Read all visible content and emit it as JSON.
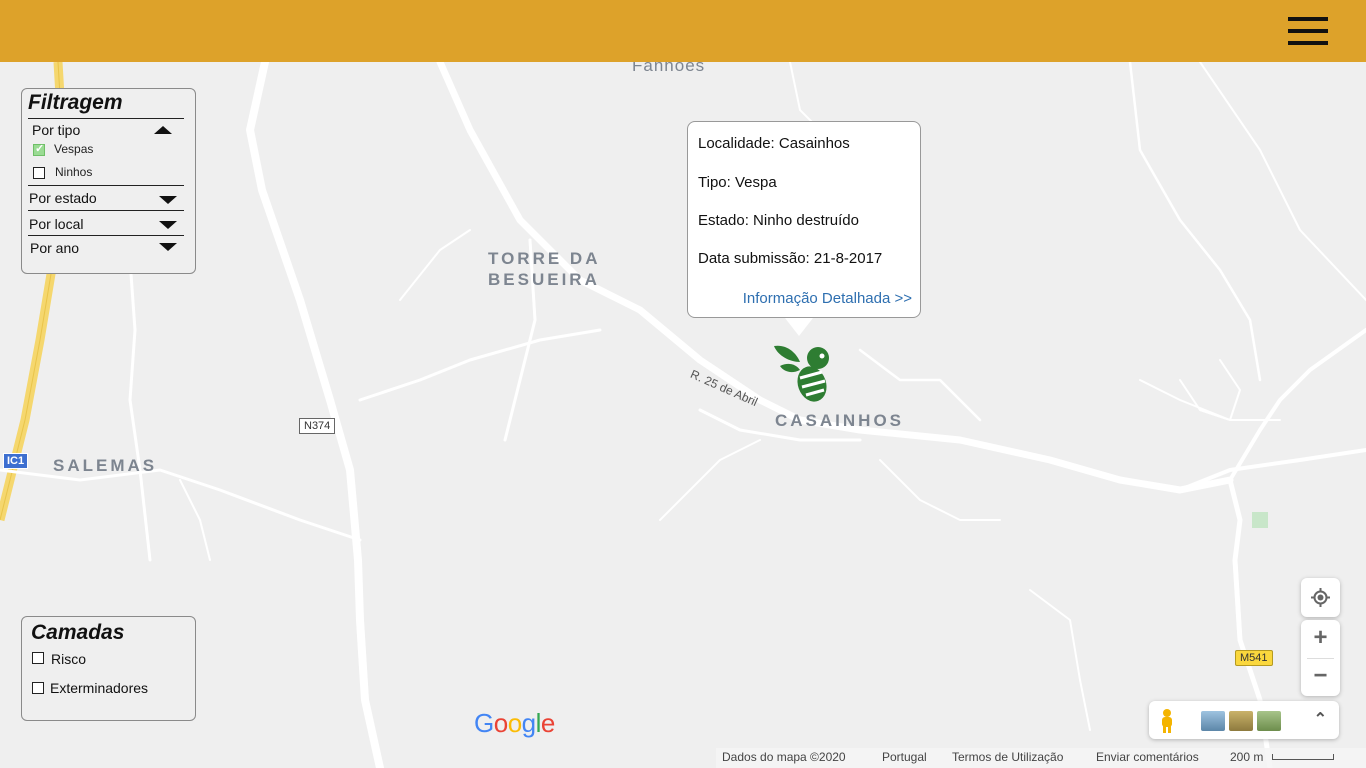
{
  "header": {
    "menu_icon": "hamburger-menu-icon",
    "background": "#dda22a"
  },
  "filter": {
    "title": "Filtragem",
    "by_type": {
      "label": "Por tipo",
      "options": [
        {
          "label": "Vespas",
          "checked": true
        },
        {
          "label": "Ninhos",
          "checked": false
        }
      ]
    },
    "by_state": "Por estado",
    "by_place": "Por local",
    "by_year": "Por ano"
  },
  "layers": {
    "title": "Camadas",
    "options": [
      {
        "label": "Risco",
        "checked": false
      },
      {
        "label": "Exterminadores",
        "checked": false
      }
    ]
  },
  "map": {
    "places": [
      "Fanhoes",
      "TORRE DA",
      "BESUEIRA",
      "CASAINHOS",
      "SALEMAS"
    ],
    "road_label": "R. 25 de Abril",
    "shields": {
      "n374": "N374",
      "ic1": "IC1",
      "m541": "M541"
    }
  },
  "info_window": {
    "locality": "Localidade: Casainhos",
    "type": "Tipo: Vespa",
    "state": "Estado: Ninho destruído",
    "date": "Data submissão: 21-8-2017",
    "link": "Informação Detalhada >>"
  },
  "marker": {
    "icon": "wasp-icon",
    "color": "#2e7d32"
  },
  "controls": {
    "locate_icon": "my-location-icon",
    "zoom_in": "+",
    "zoom_out": "−",
    "pegman_icon": "pegman-icon",
    "expand_icon": "chevron-up-icon"
  },
  "footer": {
    "map_data": "Dados do mapa ©2020",
    "country": "Portugal",
    "terms": "Termos de Utilização",
    "feedback": "Enviar comentários",
    "scale": "200 m"
  },
  "google_logo": "Google"
}
